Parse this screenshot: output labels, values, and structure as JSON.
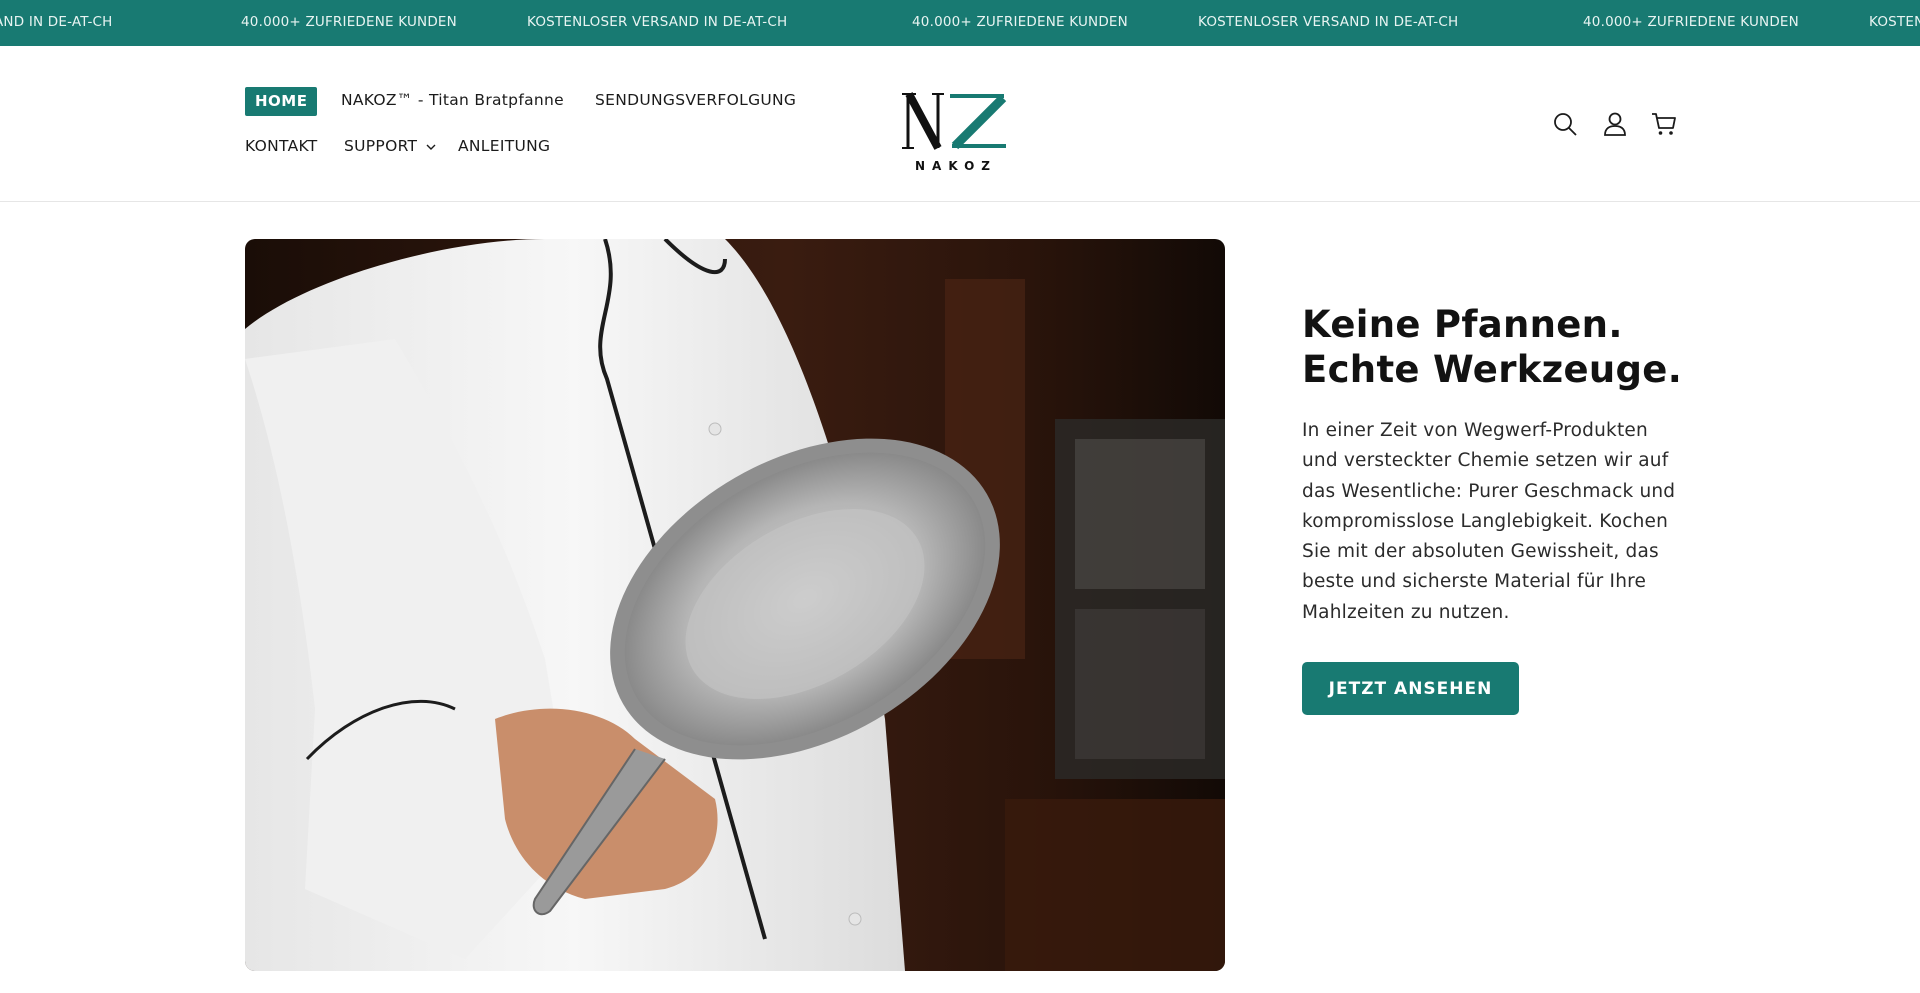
{
  "announcement": {
    "items": [
      "AND IN DE-AT-CH",
      "40.000+ ZUFRIEDENE KUNDEN",
      "KOSTENLOSER VERSAND IN DE-AT-CH",
      "40.000+ ZUFRIEDENE KUNDEN",
      "KOSTENLOSER VERSAND IN DE-AT-CH",
      "40.000+ ZUFRIEDENE KUNDEN",
      "KOSTEN"
    ]
  },
  "nav": {
    "home": "HOME",
    "product": "NAKOZ™ - Titan Bratpfanne",
    "tracking": "SENDUNGSVERFOLGUNG",
    "contact": "KONTAKT",
    "support": "SUPPORT",
    "guide": "ANLEITUNG"
  },
  "logo": {
    "mark": "NZ",
    "wordmark": "NAKOZ"
  },
  "icons": {
    "search": "search-icon",
    "account": "account-icon",
    "cart": "cart-icon"
  },
  "hero": {
    "title": "Keine Pfannen. Echte Werkzeuge.",
    "text": "In einer Zeit von Wegwerf-Produkten und versteckter Chemie setzen wir auf das Wesentliche: Purer Geschmack und kompromisslose Langlebigkeit. Kochen Sie mit der absoluten Gewissheit, das beste und sicherste Material für Ihre Mahlzeiten zu nutzen.",
    "cta": "JETZT ANSEHEN"
  },
  "colors": {
    "accent": "#187a72",
    "text": "#121212"
  }
}
